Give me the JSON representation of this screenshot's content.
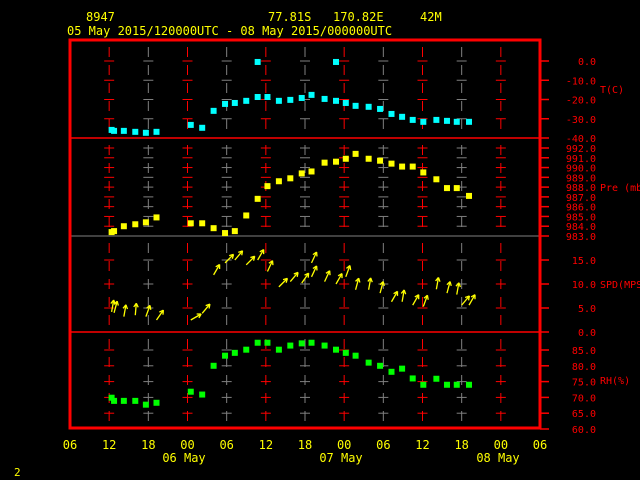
{
  "header": {
    "station": "8947",
    "lat": "77.81S",
    "lon": "170.82E",
    "elev": "42M",
    "period": "05 May 2015/120000UTC - 08 May 2015/000000UTC"
  },
  "page_number": "2",
  "colors": {
    "frame": "#ff0000",
    "temp": "#00ffff",
    "pressure": "#ffff00",
    "wind": "#ffff00",
    "rh": "#00ff00",
    "text": "#ffff00",
    "grid_alt": "#808080"
  },
  "chart_data": [
    {
      "type": "scatter",
      "ylabel": "T(C)",
      "ylim": [
        -40,
        11
      ],
      "yticks": [
        "0.0",
        "-10.0",
        "-20.0",
        "-30.0",
        "-40.0"
      ],
      "ytick_values": [
        0,
        -10,
        -20,
        -30,
        -40
      ],
      "xlim": [
        "2015-05-06 06:00",
        "2015-05-08 06:00"
      ],
      "points": [
        [
          "2015-05-06 10:15",
          -35.8
        ],
        [
          "2015-05-06 10:30",
          -36.3
        ],
        [
          "2015-05-06 11:30",
          -36.3
        ],
        [
          "2015-05-06 12:40",
          -36.8
        ],
        [
          "2015-05-06 13:45",
          -37.3
        ],
        [
          "2015-05-06 14:50",
          -36.8
        ],
        [
          "2015-05-06 18:20",
          -33.2
        ],
        [
          "2015-05-06 19:30",
          -34.7
        ],
        [
          "2015-05-06 20:40",
          -25.9
        ],
        [
          "2015-05-06 21:50",
          -22.3
        ],
        [
          "2015-05-06 22:50",
          -21.8
        ],
        [
          "2015-05-07 00:00",
          -20.7
        ],
        [
          "2015-05-07 01:10",
          -18.7
        ],
        [
          "2015-05-07 02:10",
          -18.7
        ],
        [
          "2015-05-07 03:20",
          -20.7
        ],
        [
          "2015-05-07 04:30",
          -20.2
        ],
        [
          "2015-05-07 05:40",
          -19.2
        ],
        [
          "2015-05-07 06:40",
          -17.6
        ],
        [
          "2015-05-07 08:00",
          -19.7
        ],
        [
          "2015-05-07 09:10",
          -20.7
        ],
        [
          "2015-05-07 10:10",
          -21.8
        ],
        [
          "2015-05-07 11:10",
          -23.3
        ],
        [
          "2015-05-07 12:30",
          -23.8
        ],
        [
          "2015-05-07 13:40",
          -24.9
        ],
        [
          "2015-05-07 14:50",
          -27.5
        ],
        [
          "2015-05-07 15:55",
          -29.0
        ],
        [
          "2015-05-07 17:00",
          -30.6
        ],
        [
          "2015-05-07 18:05",
          -31.6
        ],
        [
          "2015-05-07 19:25",
          -30.6
        ],
        [
          "2015-05-07 20:30",
          -31.1
        ],
        [
          "2015-05-07 21:30",
          -31.6
        ],
        [
          "2015-05-07 22:45",
          -31.6
        ],
        [
          "2015-05-07 01:10",
          -0.5
        ],
        [
          "2015-05-07 09:10",
          -0.5
        ]
      ]
    },
    {
      "type": "scatter",
      "ylabel": "Pre (mb)",
      "ylim": [
        983,
        993
      ],
      "yticks": [
        "992.0",
        "991.0",
        "990.0",
        "989.0",
        "988.0",
        "987.0",
        "986.0",
        "985.0",
        "984.0",
        "983.0"
      ],
      "ytick_values": [
        992,
        991,
        990,
        989,
        988,
        987,
        986,
        985,
        984,
        983
      ],
      "points": [
        [
          "2015-05-06 10:15",
          983.4
        ],
        [
          "2015-05-06 10:30",
          983.5
        ],
        [
          "2015-05-06 11:30",
          984.0
        ],
        [
          "2015-05-06 12:40",
          984.2
        ],
        [
          "2015-05-06 13:45",
          984.4
        ],
        [
          "2015-05-06 14:50",
          984.9
        ],
        [
          "2015-05-06 18:20",
          984.3
        ],
        [
          "2015-05-06 19:30",
          984.3
        ],
        [
          "2015-05-06 20:40",
          983.8
        ],
        [
          "2015-05-06 21:50",
          983.3
        ],
        [
          "2015-05-06 22:50",
          983.5
        ],
        [
          "2015-05-07 00:00",
          985.1
        ],
        [
          "2015-05-07 01:10",
          986.8
        ],
        [
          "2015-05-07 02:10",
          988.1
        ],
        [
          "2015-05-07 03:20",
          988.6
        ],
        [
          "2015-05-07 04:30",
          988.9
        ],
        [
          "2015-05-07 05:40",
          989.4
        ],
        [
          "2015-05-07 06:40",
          989.6
        ],
        [
          "2015-05-07 08:00",
          990.5
        ],
        [
          "2015-05-07 09:10",
          990.6
        ],
        [
          "2015-05-07 10:10",
          990.9
        ],
        [
          "2015-05-07 11:10",
          991.4
        ],
        [
          "2015-05-07 12:30",
          990.9
        ],
        [
          "2015-05-07 13:40",
          990.7
        ],
        [
          "2015-05-07 14:50",
          990.4
        ],
        [
          "2015-05-07 15:55",
          990.1
        ],
        [
          "2015-05-07 17:00",
          990.1
        ],
        [
          "2015-05-07 18:05",
          989.5
        ],
        [
          "2015-05-07 19:25",
          988.8
        ],
        [
          "2015-05-07 20:30",
          987.9
        ],
        [
          "2015-05-07 21:30",
          987.9
        ],
        [
          "2015-05-07 22:45",
          987.1
        ]
      ]
    },
    {
      "type": "vector",
      "ylabel": "SPD(MPS)",
      "ylim": [
        0,
        20
      ],
      "yticks": [
        "15.0",
        "10.0",
        "5.0",
        "0.0"
      ],
      "ytick_values": [
        15,
        10,
        5,
        0
      ],
      "points": [
        [
          "2015-05-06 10:15",
          4.2,
          10
        ],
        [
          "2015-05-06 10:30",
          4.0,
          15
        ],
        [
          "2015-05-06 11:30",
          3.2,
          10
        ],
        [
          "2015-05-06 12:40",
          3.5,
          5
        ],
        [
          "2015-05-06 13:45",
          3.2,
          20
        ],
        [
          "2015-05-06 14:50",
          2.5,
          35
        ],
        [
          "2015-05-06 18:20",
          2.5,
          60
        ],
        [
          "2015-05-06 19:30",
          3.9,
          40
        ],
        [
          "2015-05-06 20:40",
          11.9,
          30
        ],
        [
          "2015-05-06 21:50",
          14.4,
          45
        ],
        [
          "2015-05-06 22:50",
          15.0,
          40
        ],
        [
          "2015-05-07 00:00",
          14.0,
          45
        ],
        [
          "2015-05-07 01:10",
          15.0,
          30
        ],
        [
          "2015-05-07 02:10",
          12.6,
          25
        ],
        [
          "2015-05-07 03:20",
          9.4,
          45
        ],
        [
          "2015-05-07 04:30",
          10.5,
          40
        ],
        [
          "2015-05-07 05:40",
          10.2,
          35
        ],
        [
          "2015-05-07 06:40",
          11.5,
          25
        ],
        [
          "2015-05-07 06:40",
          14.4,
          25
        ],
        [
          "2015-05-07 08:00",
          10.5,
          25
        ],
        [
          "2015-05-07 09:10",
          10.0,
          30
        ],
        [
          "2015-05-07 10:10",
          11.5,
          20
        ],
        [
          "2015-05-07 11:10",
          8.8,
          15
        ],
        [
          "2015-05-07 12:30",
          8.8,
          10
        ],
        [
          "2015-05-07 13:40",
          8.1,
          15
        ],
        [
          "2015-05-07 14:50",
          6.3,
          30
        ],
        [
          "2015-05-07 15:55",
          6.3,
          10
        ],
        [
          "2015-05-07 17:00",
          5.6,
          30
        ],
        [
          "2015-05-07 18:05",
          5.3,
          20
        ],
        [
          "2015-05-07 19:25",
          8.9,
          10
        ],
        [
          "2015-05-07 20:30",
          8.1,
          15
        ],
        [
          "2015-05-07 21:30",
          7.8,
          10
        ],
        [
          "2015-05-07 22:00",
          5.6,
          40
        ],
        [
          "2015-05-07 22:45",
          5.6,
          30
        ]
      ]
    },
    {
      "type": "scatter",
      "ylabel": "RH(%)",
      "ylim": [
        60,
        90.7
      ],
      "yticks": [
        "85.0",
        "80.0",
        "75.0",
        "70.0",
        "65.0",
        "60.0"
      ],
      "ytick_values": [
        85,
        80,
        75,
        70,
        65,
        60
      ],
      "points": [
        [
          "2015-05-06 10:15",
          69.9
        ],
        [
          "2015-05-06 10:30",
          68.9
        ],
        [
          "2015-05-06 11:30",
          68.9
        ],
        [
          "2015-05-06 12:40",
          68.9
        ],
        [
          "2015-05-06 13:45",
          67.7
        ],
        [
          "2015-05-06 14:50",
          68.3
        ],
        [
          "2015-05-06 18:20",
          71.8
        ],
        [
          "2015-05-06 19:30",
          70.9
        ],
        [
          "2015-05-06 20:40",
          80.0
        ],
        [
          "2015-05-06 21:50",
          83.2
        ],
        [
          "2015-05-06 22:50",
          84.1
        ],
        [
          "2015-05-07 00:00",
          85.1
        ],
        [
          "2015-05-07 01:10",
          87.3
        ],
        [
          "2015-05-07 02:10",
          87.3
        ],
        [
          "2015-05-07 03:20",
          85.1
        ],
        [
          "2015-05-07 04:30",
          86.4
        ],
        [
          "2015-05-07 05:40",
          87.1
        ],
        [
          "2015-05-07 06:40",
          87.3
        ],
        [
          "2015-05-07 08:00",
          86.4
        ],
        [
          "2015-05-07 09:10",
          85.1
        ],
        [
          "2015-05-07 10:10",
          84.1
        ],
        [
          "2015-05-07 11:10",
          83.2
        ],
        [
          "2015-05-07 12:30",
          81.0
        ],
        [
          "2015-05-07 13:40",
          80.0
        ],
        [
          "2015-05-07 14:50",
          78.1
        ],
        [
          "2015-05-07 15:55",
          79.1
        ],
        [
          "2015-05-07 17:00",
          76.0
        ],
        [
          "2015-05-07 18:05",
          74.0
        ],
        [
          "2015-05-07 19:25",
          75.9
        ],
        [
          "2015-05-07 20:30",
          74.0
        ],
        [
          "2015-05-07 21:30",
          74.0
        ],
        [
          "2015-05-07 22:45",
          74.0
        ]
      ]
    }
  ],
  "x_axis": {
    "hour_labels": [
      "06",
      "12",
      "18",
      "00",
      "06",
      "12",
      "18",
      "00",
      "06",
      "12",
      "18",
      "00",
      "06"
    ],
    "date_labels": [
      {
        "text": "06 May",
        "at": "2015-05-07 00:00"
      },
      {
        "text": "07 May",
        "at": "2015-05-07 00:00"
      },
      {
        "text": "08 May",
        "at": "2015-05-08 00:00"
      }
    ]
  }
}
